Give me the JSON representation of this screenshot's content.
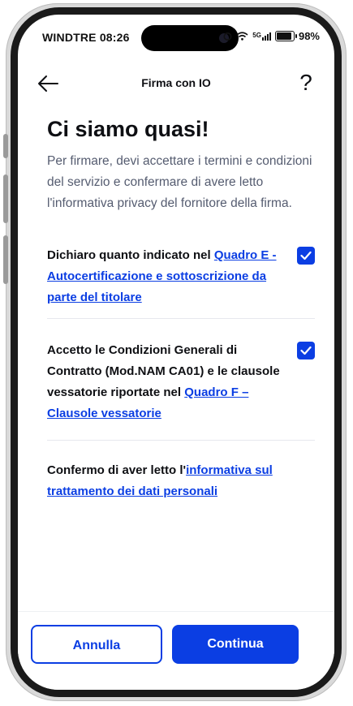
{
  "status_bar": {
    "carrier_time": "WINDTRE 08:26",
    "network": "5G",
    "battery": "98%",
    "battery_level": 0.98
  },
  "header": {
    "title": "Firma con IO",
    "back_icon": "arrow-left-icon",
    "help_icon": "question-mark-icon",
    "help_label": "?"
  },
  "main": {
    "title": "Ci siamo quasi!",
    "intro": "Per firmare, devi accettare i termini e condizioni del servizio e confermare di avere letto l'informativa privacy del fornitore della firma."
  },
  "items": [
    {
      "text": "Dichiaro quanto indicato nel ",
      "link": "Quadro E - Autocertificazione e sottoscrizione da parte del titolare",
      "checked": true
    },
    {
      "text": "Accetto le Condizioni Generali di Contratto (Mod.NAM CA01) e le clausole vessatorie riportate nel ",
      "link": "Quadro F – Clausole vessatorie",
      "checked": true
    },
    {
      "text": "Confermo di aver letto l'",
      "link": "informativa sul trattamento dei dati personali",
      "checked": false
    }
  ],
  "footer": {
    "cancel_label": "Annulla",
    "continue_label": "Continua"
  },
  "colors": {
    "accent": "#0b3ee3",
    "text": "#0e0f13",
    "muted": "#555c70"
  }
}
